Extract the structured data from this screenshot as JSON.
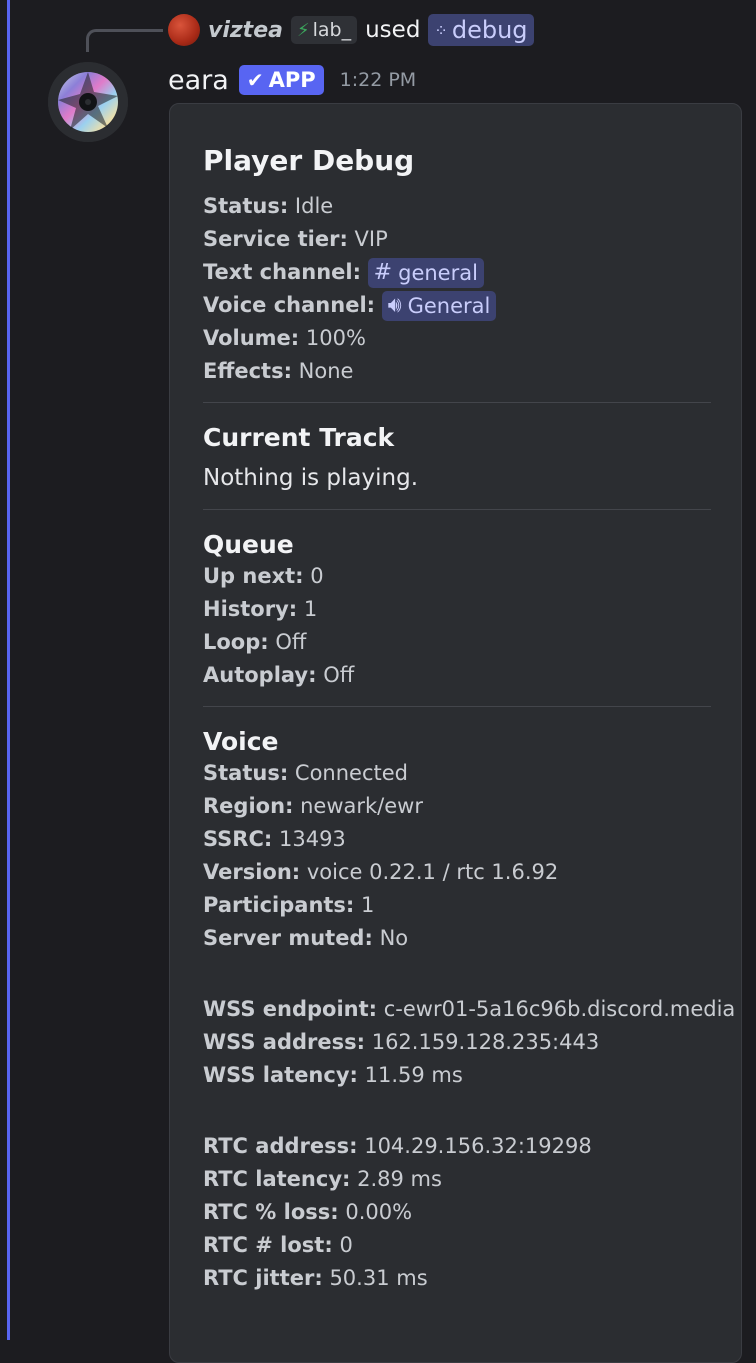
{
  "reply": {
    "username": "viztea",
    "tag_text": "lab_",
    "used_text": "used",
    "command": "debug"
  },
  "message": {
    "author": "eara",
    "app_badge": "APP",
    "timestamp": "1:22 PM"
  },
  "embed": {
    "title": "Player Debug",
    "player_fields": [
      {
        "label": "Status:",
        "value": "Idle"
      },
      {
        "label": "Service tier:",
        "value": "VIP"
      }
    ],
    "text_channel": {
      "label": "Text channel:",
      "icon": "hash-icon",
      "value": "general"
    },
    "voice_channel": {
      "label": "Voice channel:",
      "icon": "speaker-icon",
      "value": "General"
    },
    "player_fields_2": [
      {
        "label": "Volume:",
        "value": "100%"
      },
      {
        "label": "Effects:",
        "value": "None"
      }
    ],
    "current_track": {
      "title": "Current Track",
      "text": "Nothing is playing."
    },
    "queue": {
      "title": "Queue",
      "fields": [
        {
          "label": "Up next:",
          "value": "0"
        },
        {
          "label": "History:",
          "value": "1"
        },
        {
          "label": "Loop:",
          "value": "Off"
        },
        {
          "label": "Autoplay:",
          "value": "Off"
        }
      ]
    },
    "voice": {
      "title": "Voice",
      "fields": [
        {
          "label": "Status:",
          "value": "Connected"
        },
        {
          "label": "Region:",
          "value": "newark/ewr"
        },
        {
          "label": "SSRC:",
          "value": "13493"
        },
        {
          "label": "Version:",
          "value": "voice 0.22.1 / rtc 1.6.92"
        },
        {
          "label": "Participants:",
          "value": "1"
        },
        {
          "label": "Server muted:",
          "value": "No"
        }
      ],
      "wss_fields": [
        {
          "label": "WSS endpoint:",
          "value": "c-ewr01-5a16c96b.discord.media"
        },
        {
          "label": "WSS address:",
          "value": "162.159.128.235:443"
        },
        {
          "label": "WSS latency:",
          "value": "11.59 ms"
        }
      ],
      "rtc_fields": [
        {
          "label": "RTC address:",
          "value": "104.29.156.32:19298"
        },
        {
          "label": "RTC latency:",
          "value": "2.89 ms"
        },
        {
          "label": "RTC % loss:",
          "value": "0.00%"
        },
        {
          "label": "RTC # lost:",
          "value": "0"
        },
        {
          "label": "RTC jitter:",
          "value": "50.31 ms"
        }
      ]
    }
  },
  "colors": {
    "mention_bar": "#5865f2",
    "app_badge": "#5865f2",
    "mention_pill_bg": "#3c4270",
    "embed_bg": "#2b2d31"
  }
}
